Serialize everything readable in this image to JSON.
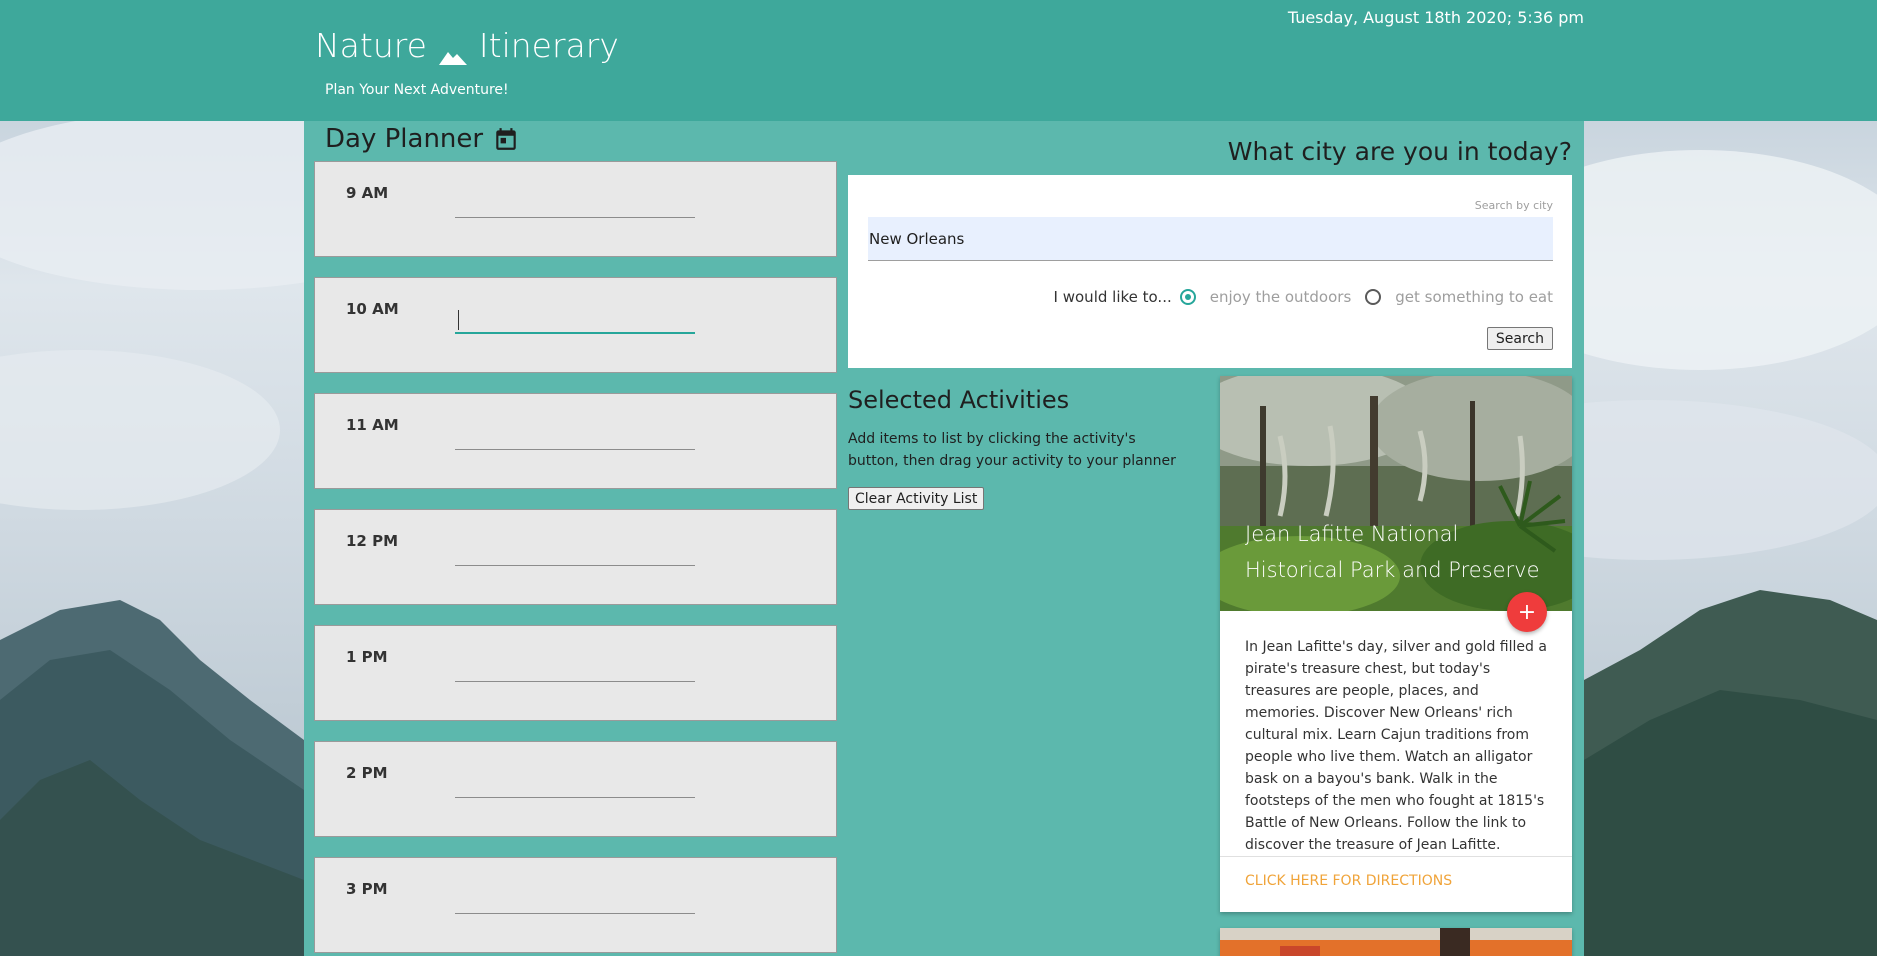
{
  "header": {
    "brand_left": "Nature",
    "brand_right": "Itinerary",
    "tagline": "Plan Your Next Adventure!",
    "datetime": "Tuesday, August 18th 2020; 5:36 pm"
  },
  "planner": {
    "title": "Day Planner",
    "hours": [
      {
        "label": "9 AM",
        "value": ""
      },
      {
        "label": "10 AM",
        "value": ""
      },
      {
        "label": "11 AM",
        "value": ""
      },
      {
        "label": "12 PM",
        "value": ""
      },
      {
        "label": "1 PM",
        "value": ""
      },
      {
        "label": "2 PM",
        "value": ""
      },
      {
        "label": "3 PM",
        "value": ""
      }
    ]
  },
  "search": {
    "heading": "What city are you in today?",
    "hint": "Search by city",
    "value": "New Orleans",
    "lead": "I would like to...",
    "option_outdoors": "enjoy the outdoors",
    "option_eat": "get something to eat",
    "selected_option": "enjoy the outdoors",
    "button": "Search"
  },
  "selected": {
    "title": "Selected Activities",
    "description": "Add items to list by clicking the activity's button, then drag your activity to your planner",
    "clear_button": "Clear Activity List"
  },
  "activity": {
    "title": "Jean Lafitte National Historical Park and Preserve",
    "add_symbol": "+",
    "body": "In Jean Lafitte's day, silver and gold filled a pirate's treasure chest, but today's treasures are people, places, and memories. Discover New Orleans' rich cultural mix. Learn Cajun traditions from people who live them. Watch an alligator bask on a bayou's bank. Walk in the footsteps of the men who fought at 1815's Battle of New Orleans. Follow the link to discover the treasure of Jean Lafitte.",
    "link": "CLICK HERE FOR DIRECTIONS"
  },
  "colors": {
    "header": "#3ea89b",
    "panel": "#5cb8ad",
    "accent": "#26a69a",
    "fab": "#ef3c3c",
    "link": "#f0a43a"
  },
  "icons": {
    "brand": "mountain-icon",
    "planner": "calendar-icon"
  }
}
